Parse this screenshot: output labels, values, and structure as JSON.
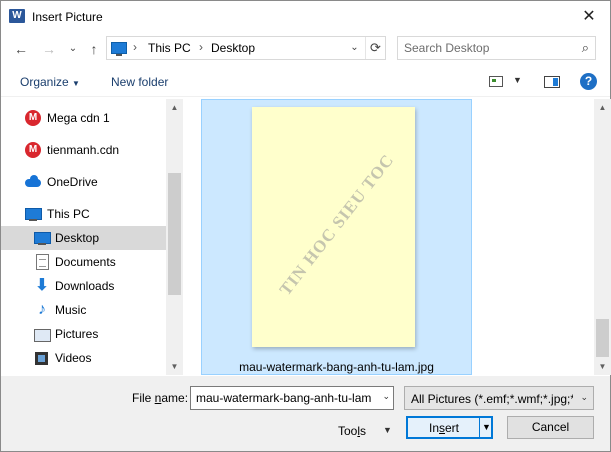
{
  "window": {
    "app_icon": "W",
    "title": "Insert Picture",
    "close": "✕"
  },
  "address": {
    "back": "←",
    "forward": "→",
    "recent": "⌄",
    "up": "↑",
    "crumbs": [
      "This PC",
      "Desktop"
    ],
    "separator": "›",
    "dropdown": "⌄",
    "refresh": "⟳"
  },
  "search": {
    "placeholder": "Search Desktop",
    "icon": "⌕"
  },
  "toolbar": {
    "organize": "Organize",
    "organize_dd": "▼",
    "new_folder": "New folder",
    "view_dd": "▼",
    "help": "?"
  },
  "nav": {
    "items": [
      {
        "label": "Mega cdn 1",
        "icon": "mega-icon",
        "glyph": "M"
      },
      {
        "label": "tienmanh.cdn",
        "icon": "mega-icon",
        "glyph": "M"
      },
      {
        "label": "OneDrive",
        "icon": "onedrive-icon"
      },
      {
        "label": "This PC",
        "icon": "this-pc-icon"
      },
      {
        "label": "Desktop",
        "icon": "desktop-icon",
        "selected": true
      },
      {
        "label": "Documents",
        "icon": "documents-icon"
      },
      {
        "label": "Downloads",
        "icon": "downloads-icon",
        "glyph": "⬇"
      },
      {
        "label": "Music",
        "icon": "music-icon",
        "glyph": "♪"
      },
      {
        "label": "Pictures",
        "icon": "pictures-icon"
      },
      {
        "label": "Videos",
        "icon": "videos-icon"
      }
    ],
    "scroll_up": "▲",
    "scroll_down": "▼"
  },
  "files": {
    "items": [
      {
        "name": "mau-watermark-bang-anh-tu-lam.jpg",
        "watermark_text": "TIN HOC SIEU TOC",
        "selected": true
      }
    ],
    "scroll_up": "▲",
    "scroll_down": "▼"
  },
  "bottom": {
    "file_name_label_pre": "File ",
    "file_name_label_u": "n",
    "file_name_label_post": "ame:",
    "file_name_value": "mau-watermark-bang-anh-tu-lam",
    "file_name_dd": "⌄",
    "filter": "All Pictures (*.emf;*.wmf;*.jpg;*",
    "filter_dd": "⌄",
    "tools_pre": "Too",
    "tools_u": "l",
    "tools_post": "s",
    "tools_dd": "▼",
    "insert_pre": "In",
    "insert_u": "s",
    "insert_post": "ert",
    "insert_dd": "▼",
    "cancel": "Cancel"
  },
  "colors": {
    "selection": "#cce8ff",
    "selection_border": "#99d1ff",
    "accent": "#0078d7",
    "nav_selected": "#d9d9d9",
    "thumbnail_paper": "#ffffcc"
  }
}
